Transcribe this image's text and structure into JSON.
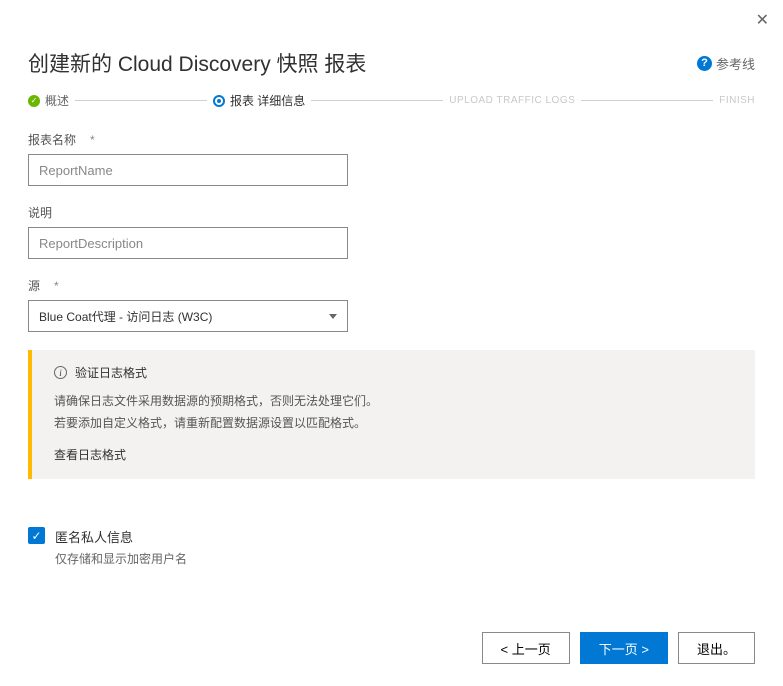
{
  "close": "✕",
  "title": "创建新的 Cloud Discovery 快照 报表",
  "help": {
    "icon": "?",
    "label": "参考线"
  },
  "stepper": {
    "s1": "概述",
    "s2": "报表 详细信息",
    "s3": "UPLOAD TRAFFIC LOGS",
    "s4": "FINISH"
  },
  "fields": {
    "name_label": "报表名称",
    "name_placeholder": "ReportName",
    "desc_label": "说明",
    "desc_placeholder": "ReportDescription",
    "source_label": "源",
    "source_value": "Blue Coat代理 - 访问日志 (W3C)",
    "req": "*"
  },
  "info": {
    "title": "验证日志格式",
    "line1": "请确保日志文件采用数据源的预期格式，否则无法处理它们。",
    "line2": "若要添加自定义格式，请重新配置数据源设置以匹配格式。",
    "link": "查看日志格式"
  },
  "anon": {
    "label": "匿名私人信息",
    "sub": "仅存储和显示加密用户名"
  },
  "buttons": {
    "prev": "< 上一页",
    "next": "下一页 >",
    "exit": "退出。"
  }
}
